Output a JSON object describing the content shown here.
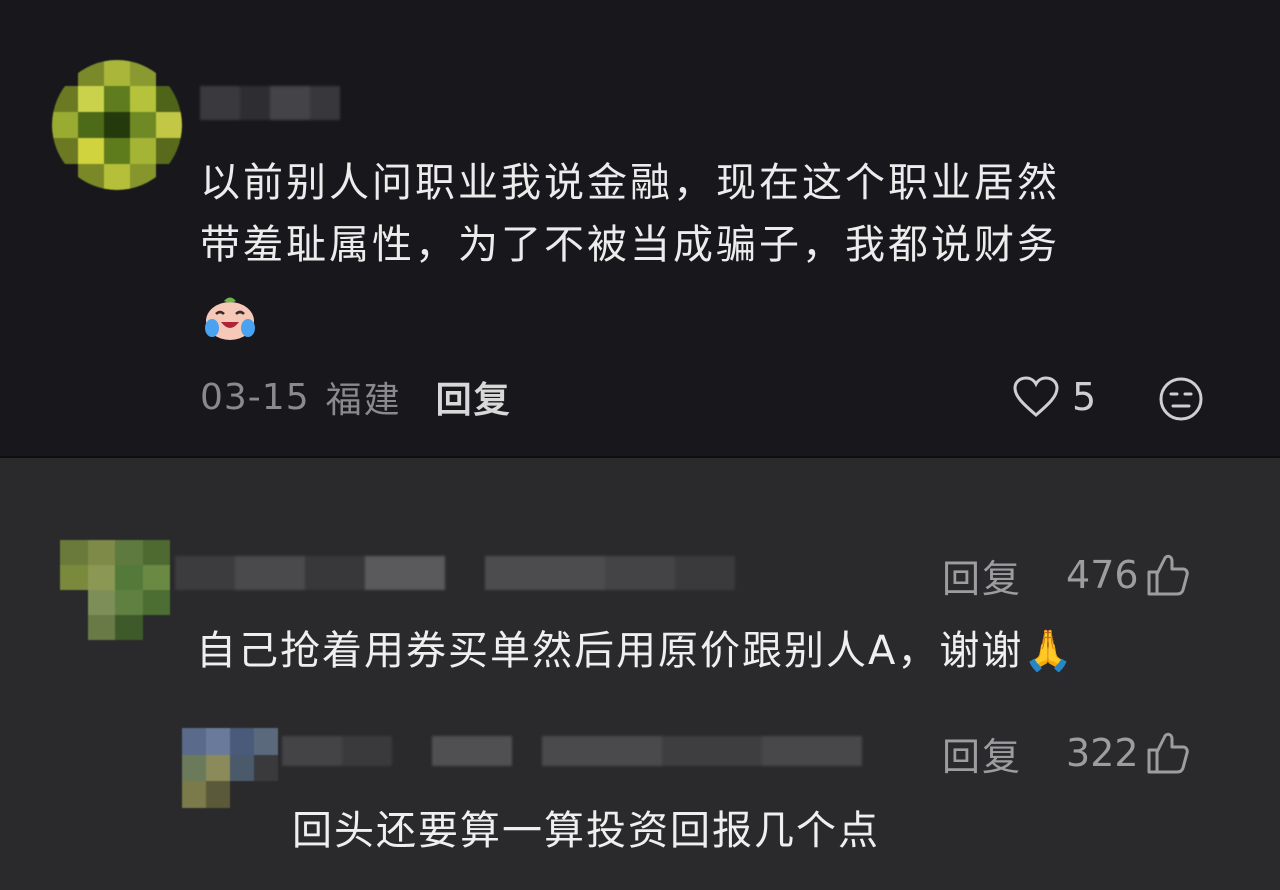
{
  "comment": {
    "text_line1": "以前别人问职业我说金融，现在这个职业居然",
    "text_line2": "带羞耻属性，为了不被当成骗子，我都说财务",
    "emoji": "crying-laughing-face",
    "date": "03-15",
    "location": "福建",
    "reply_label": "回复",
    "like_count": "5"
  },
  "replies": [
    {
      "reply_label": "回复",
      "like_count": "476",
      "text": "自己抢着用券买单然后用原价跟别人A，谢谢🙏"
    },
    {
      "reply_label": "回复",
      "like_count": "322",
      "text": "回头还要算一算投资回报几个点"
    }
  ],
  "colors": {
    "top_bg": "#18181c",
    "bottom_bg": "#2a2a2c",
    "muted_text": "#8a8a8e"
  }
}
